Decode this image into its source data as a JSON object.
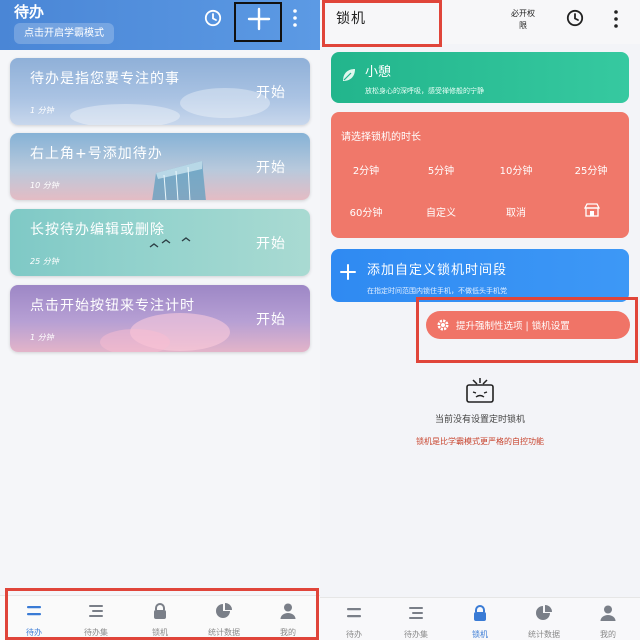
{
  "left": {
    "title": "待办",
    "study_mode_chip": "点击开启学霸模式",
    "icons": {
      "clock": "clock-icon",
      "add": "plus-icon",
      "more": "more-vertical-icon"
    },
    "cards": [
      {
        "title": "待办是指您要专注的事",
        "duration": "1 分钟",
        "start": "开始"
      },
      {
        "title": "右上角+号添加待办",
        "duration": "10 分钟",
        "start": "开始"
      },
      {
        "title": "长按待办编辑或删除",
        "duration": "25 分钟",
        "start": "开始"
      },
      {
        "title": "点击开始按钮来专注计时",
        "duration": "1 分钟",
        "start": "开始"
      }
    ],
    "nav": [
      {
        "label": "待办",
        "icon": "todo-list-icon",
        "active": true
      },
      {
        "label": "待办集",
        "icon": "todo-set-icon",
        "active": false
      },
      {
        "label": "锁机",
        "icon": "lock-icon",
        "active": false
      },
      {
        "label": "统计数据",
        "icon": "pie-chart-icon",
        "active": false
      },
      {
        "label": "我的",
        "icon": "user-icon",
        "active": false
      }
    ]
  },
  "right": {
    "title": "锁机",
    "permission": "必开权限",
    "mini_break": {
      "title": "小憩",
      "subtitle": "放松身心的深呼吸，感受禅修般的宁静"
    },
    "duration_panel": {
      "title": "请选择锁机的时长",
      "options": [
        "2分钟",
        "5分钟",
        "10分钟",
        "25分钟",
        "60分钟",
        "自定义",
        "取消"
      ]
    },
    "add_segment": {
      "title": "添加自定义锁机时间段",
      "subtitle": "在指定时间范围内锁住手机，不做低头手机党"
    },
    "settings_button": "提升强制性选项 | 锁机设置",
    "empty_text": "当前没有设置定时锁机",
    "empty_note": "锁机是比学霸模式更严格的自控功能",
    "nav": [
      {
        "label": "待办",
        "icon": "todo-list-icon",
        "active": false
      },
      {
        "label": "待办集",
        "icon": "todo-set-icon",
        "active": false
      },
      {
        "label": "锁机",
        "icon": "lock-icon",
        "active": true
      },
      {
        "label": "统计数据",
        "icon": "pie-chart-icon",
        "active": false
      },
      {
        "label": "我的",
        "icon": "user-icon",
        "active": false
      }
    ]
  },
  "colors": {
    "primary_blue": "#4a86d6",
    "nav_active": "#3a7bd5",
    "nav_inactive": "#7a7f88",
    "mini_green": "#22b58c",
    "salmon": "#f0786a",
    "add_blue": "#2f8af2",
    "highlight_red": "#e0453a"
  }
}
